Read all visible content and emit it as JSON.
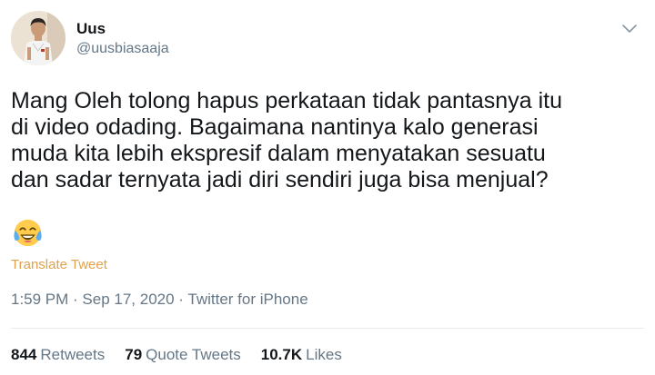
{
  "author": {
    "name": "Uus",
    "handle": "@uusbiasaaja"
  },
  "tweet": {
    "lines": [
      "Mang Oleh tolong hapus perkataan tidak pantasnya itu",
      "di video odading. Bagaimana nantinya kalo generasi",
      "muda kita lebih ekspresif dalam menyatakan sesuatu",
      "dan sadar ternyata jadi diri sendiri juga bisa menjual?"
    ],
    "emoji": "face-with-tears-of-joy",
    "translate_label": "Translate Tweet"
  },
  "meta": {
    "time": "1:59 PM",
    "separator": " · ",
    "date": "Sep 17, 2020",
    "source": "Twitter for iPhone"
  },
  "stats": {
    "retweets_count": "844",
    "retweets_label": "Retweets",
    "quotes_count": "79",
    "quotes_label": "Quote Tweets",
    "likes_count": "10.7K",
    "likes_label": "Likes"
  },
  "colors": {
    "text": "#14171a",
    "secondary": "#657786",
    "translate": "#e0a24a",
    "divider": "#e6ecf0"
  },
  "icons": {
    "menu": "chevron-down-icon",
    "emoji": "laughing-tears-emoji-icon"
  }
}
